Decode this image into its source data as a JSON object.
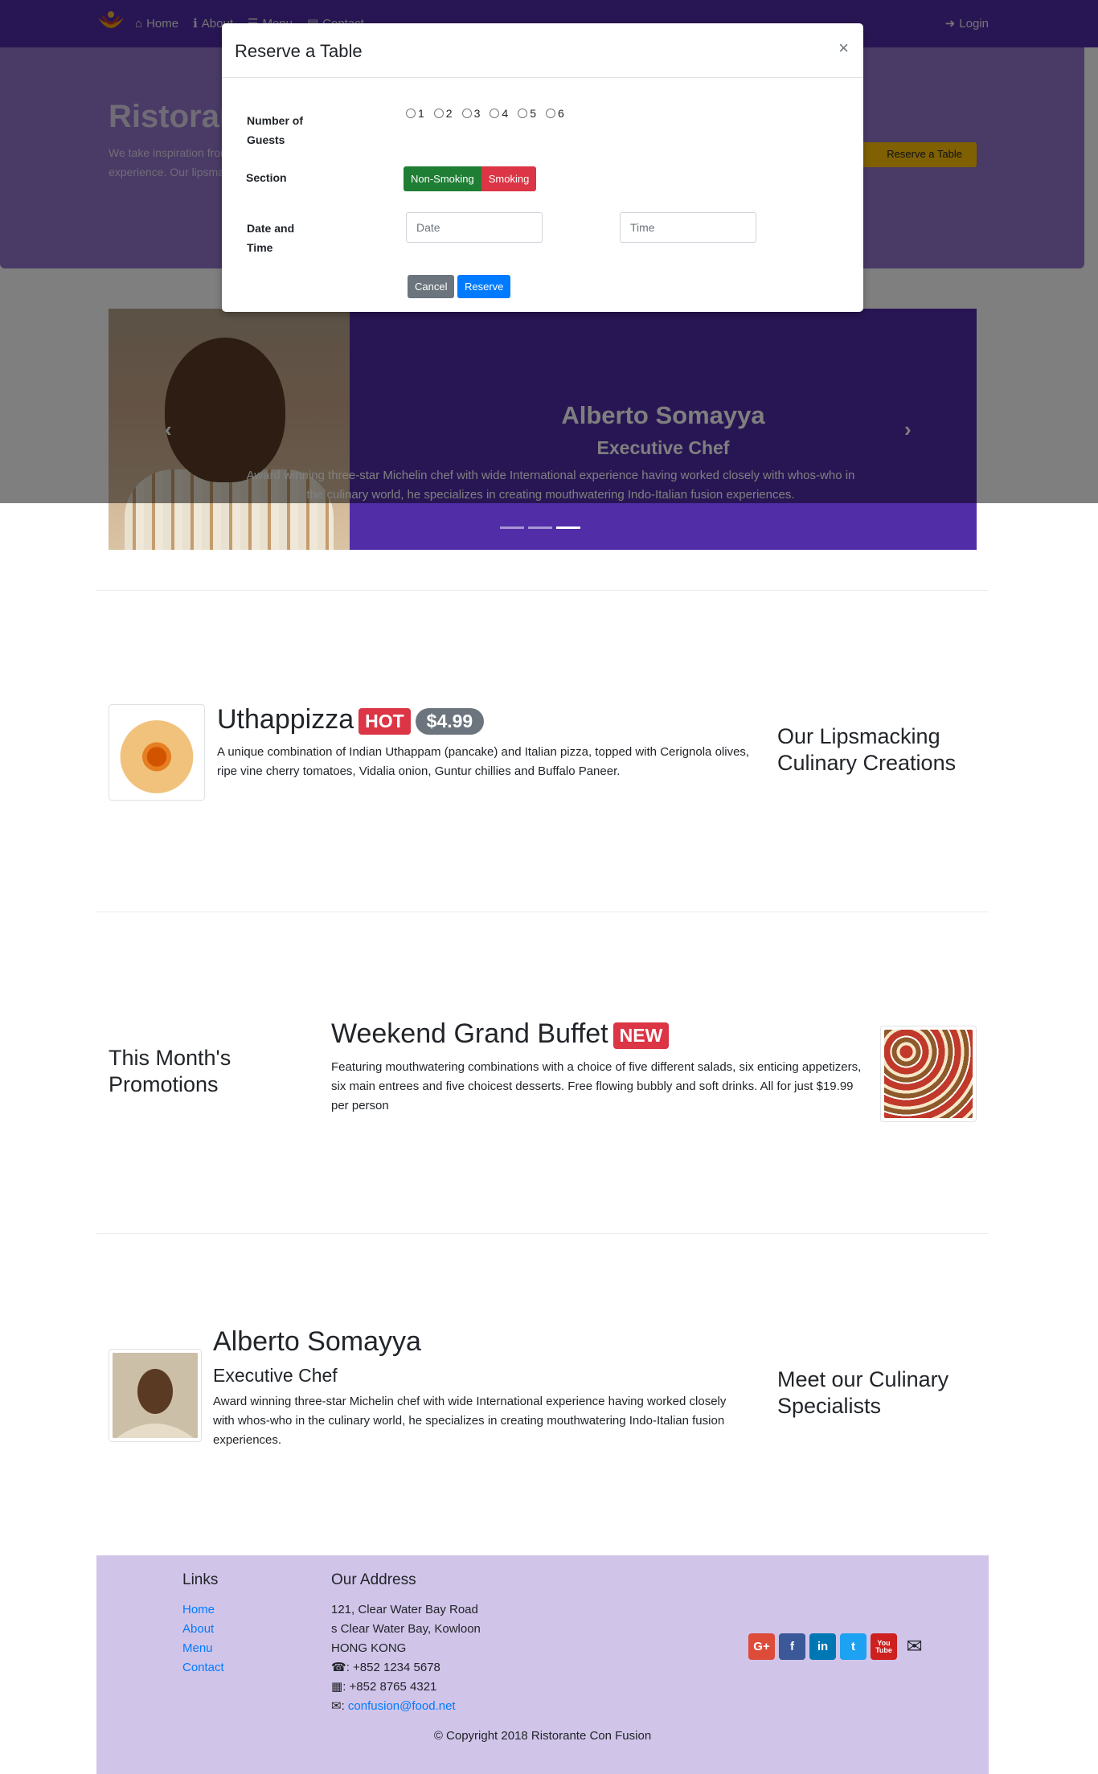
{
  "navbar": {
    "items": [
      "Home",
      "About",
      "Menu",
      "Contact"
    ],
    "login": "Login"
  },
  "jumbotron": {
    "title": "Ristorante con Fusion",
    "description": "We take inspiration from the World's best cuisines, and create a unique fusion experience. Our lipsmacking creations will tickle your culinary senses!",
    "button": "Reserve a Table"
  },
  "carousel": {
    "name": "Alberto Somayya",
    "role": "Executive Chef",
    "description": "Award winning three-star Michelin chef with wide International experience having worked closely with whos-who in the culinary world, he specializes in creating mouthwatering Indo-Italian fusion experiences.",
    "next_icon": "chevron-right-icon",
    "prev_icon": "chevron-left-icon",
    "active_indicator": 3,
    "indicators": 3
  },
  "modal": {
    "title": "Reserve a Table",
    "close": "×",
    "guests_label": "Number of Guests",
    "guest_options": [
      "1",
      "2",
      "3",
      "4",
      "5",
      "6"
    ],
    "section_label": "Section",
    "section_options": [
      "Non-Smoking",
      "Smoking"
    ],
    "datetime_label": "Date and Time",
    "date_placeholder": "Date",
    "time_placeholder": "Time",
    "cancel": "Cancel",
    "reserve": "Reserve"
  },
  "dish": {
    "name": "Uthappizza",
    "badge": "HOT",
    "price": "$4.99",
    "description": "A unique combination of Indian Uthappam (pancake) and Italian pizza, topped with Cerignola olives, ripe vine cherry tomatoes, Vidalia onion, Guntur chillies and Buffalo Paneer.",
    "section_title": "Our Lipsmacking Culinary Creations"
  },
  "promotion": {
    "section_title": "This Month's Promotions",
    "name": "Weekend Grand Buffet",
    "badge": "NEW",
    "description": "Featuring mouthwatering combinations with a choice of five different salads, six enticing appetizers, six main entrees and five choicest desserts. Free flowing bubbly and soft drinks. All for just $19.99 per person"
  },
  "leader": {
    "name": "Alberto Somayya",
    "role": "Executive Chef",
    "description": "Award winning three-star Michelin chef with wide International experience having worked closely with whos-who in the culinary world, he specializes in creating mouthwatering Indo-Italian fusion experiences.",
    "section_title": "Meet our Culinary Specialists"
  },
  "footer": {
    "links_title": "Links",
    "links": [
      "Home",
      "About",
      "Menu",
      "Contact"
    ],
    "address_title": "Our Address",
    "address_lines": [
      "121, Clear Water Bay Road",
      "s Clear Water Bay, Kowloon",
      "HONG KONG"
    ],
    "phone": ": +852 1234 5678",
    "fax": ": +852 8765 4321",
    "email_prefix": ": ",
    "email": "confusion@food.net",
    "copyright": "© Copyright 2018 Ristorante Con Fusion",
    "socials": [
      "G+",
      "f",
      "in",
      "t",
      "You Tube"
    ]
  },
  "colors": {
    "primary": "#512da8",
    "light": "#9575cd",
    "footer": "#d1c4e9",
    "hot": "#dc3545",
    "price": "#6c757d",
    "nonsmoking": "#1e7e34",
    "reserve": "#007bff"
  }
}
